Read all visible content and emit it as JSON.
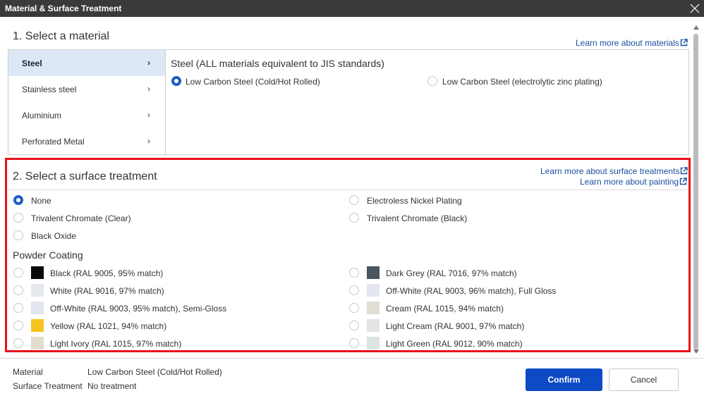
{
  "dialog": {
    "title": "Material & Surface Treatment"
  },
  "materials": {
    "heading": "1. Select a material",
    "learn_more": "Learn more about materials",
    "items": [
      {
        "label": "Steel",
        "active": true
      },
      {
        "label": "Stainless steel",
        "active": false
      },
      {
        "label": "Aluminium",
        "active": false
      },
      {
        "label": "Perforated Metal",
        "active": false
      }
    ],
    "detail_title": "Steel (ALL materials equivalent to JIS standards)",
    "options": [
      {
        "label": "Low Carbon Steel (Cold/Hot Rolled)",
        "selected": true
      },
      {
        "label": "Low Carbon Steel (electrolytic zinc plating)",
        "selected": false
      }
    ]
  },
  "surface": {
    "heading": "2. Select a surface treatment",
    "learn_more_treatments": "Learn more about surface treatments",
    "learn_more_painting": "Learn more about painting",
    "options": [
      {
        "label": "None",
        "selected": true
      },
      {
        "label": "Electroless Nickel Plating",
        "selected": false
      },
      {
        "label": "Trivalent Chromate (Clear)",
        "selected": false
      },
      {
        "label": "Trivalent Chromate (Black)",
        "selected": false
      },
      {
        "label": "Black Oxide",
        "selected": false
      }
    ],
    "powder_heading": "Powder Coating",
    "powder": [
      {
        "label": "Black (RAL 9005, 95% match)",
        "color": "#0a0a0a"
      },
      {
        "label": "Dark Grey (RAL 7016, 97% match)",
        "color": "#4a5562"
      },
      {
        "label": "White (RAL 9016, 97% match)",
        "color": "#e5e9ed"
      },
      {
        "label": "Off-White (RAL 9003, 96% match), Full Gloss",
        "color": "#e3e6ef"
      },
      {
        "label": "Off-White (RAL 9003, 95% match), Semi-Gloss",
        "color": "#e3e6ef"
      },
      {
        "label": "Cream (RAL 1015, 94% match)",
        "color": "#e0ddd4"
      },
      {
        "label": "Yellow (RAL 1021, 94% match)",
        "color": "#f5c320"
      },
      {
        "label": "Light Cream (RAL 9001, 97% match)",
        "color": "#e4e4e4"
      },
      {
        "label": "Light Ivory (RAL 1015, 97% match)",
        "color": "#e3dccd"
      },
      {
        "label": "Light Green (RAL 9012, 90% match)",
        "color": "#dbe6e4"
      }
    ]
  },
  "summary": {
    "material_key": "Material",
    "material_value": "Low Carbon Steel (Cold/Hot Rolled)",
    "surface_key": "Surface Treatment",
    "surface_value": "No treatment"
  },
  "buttons": {
    "confirm": "Confirm",
    "cancel": "Cancel"
  },
  "colors": {
    "accent": "#1b5fc4",
    "confirm_bg": "#0d4ac6",
    "link": "#1a4fa0",
    "highlight": "#e8131b"
  },
  "icons": {
    "close": "close-icon",
    "external": "external-link-icon",
    "chevron": "chevron-right-icon"
  }
}
